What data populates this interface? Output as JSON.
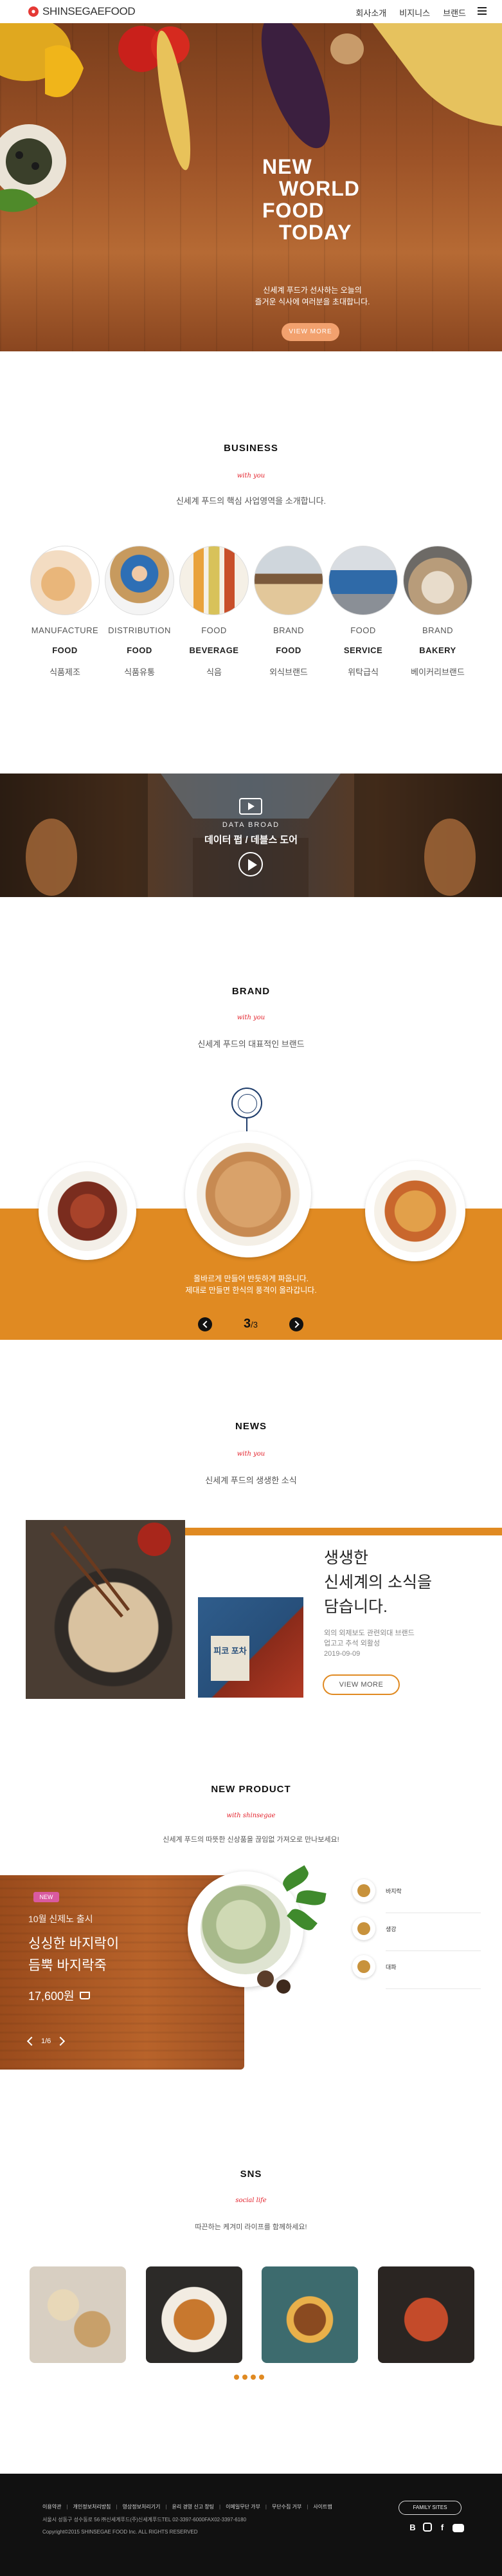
{
  "header": {
    "logo_text": "SHINSEGAEFOOD",
    "nav": [
      "회사소개",
      "비지니스",
      "브랜드"
    ]
  },
  "hero": {
    "title_lines": [
      "NEW",
      "WORLD",
      "FOOD",
      "TODAY"
    ],
    "subtitle_lines": [
      "신세계 푸드가 선사하는 오늘의",
      "즐거운 식사에 여러분을 초대합니다."
    ],
    "button": "VIEW MORE"
  },
  "business": {
    "title": "BUSINESS",
    "script": "with you",
    "desc": "신세계 푸드의 핵심 사업영역을 소개합니다.",
    "items": [
      {
        "t1": "MANUFACTURE",
        "t2": "FOOD",
        "t3": "식품제조"
      },
      {
        "t1": "DISTRIBUTION",
        "t2": "FOOD",
        "t3": "식품유통"
      },
      {
        "t1": "FOOD",
        "t2": "BEVERAGE",
        "t3": "식음"
      },
      {
        "t1": "BRAND",
        "t2": "FOOD",
        "t3": "외식브랜드"
      },
      {
        "t1": "FOOD",
        "t2": "SERVICE",
        "t3": "위탁급식"
      },
      {
        "t1": "BRAND",
        "t2": "BAKERY",
        "t3": "베이커리브랜드"
      }
    ]
  },
  "video": {
    "small": "DATA BROAD",
    "big": "데이터 펍 / 데블스 도어"
  },
  "brand": {
    "title": "BRAND",
    "script": "with you",
    "desc": "신세계 푸드의 대표적인 브랜드",
    "text_lines": [
      "올바르게 만들어 반듯하게 파웁니다.",
      "제대로 만들면 한식의 풍격이 올라갑니다."
    ],
    "page_current": "3",
    "page_total": "/3"
  },
  "news": {
    "title": "NEWS",
    "script": "with you",
    "desc": "신세계 푸드의 생생한 소식",
    "headline_lines": [
      "생생한",
      "신세계의 소식을",
      "담습니다."
    ],
    "meta_lines": [
      "외의 외제보도 관련외대 브랜드",
      "업고고 추석 외활성",
      "2019-09-09"
    ],
    "button": "VIEW MORE",
    "thumb_text": "피코 포차"
  },
  "product": {
    "title": "NEW PRODUCT",
    "script": "with shinsegae",
    "desc": "신세계 푸드의 따뜻한 신상품을 끊임없 가져오로 만나보세요!",
    "badge": "NEW",
    "category": "10월 신제노 출시",
    "name_lines": [
      "싱싱한 바지락이",
      "듬뿍 바지락죽"
    ],
    "price": "17,600원",
    "pager": "1/6",
    "list": [
      "바지락",
      "생강",
      "대파"
    ]
  },
  "sns": {
    "title": "SNS",
    "script": "social life",
    "desc": "따끈하는 케겨미 라이프를 함께하세요!"
  },
  "footer": {
    "links": [
      "이용약관",
      "개인정보처리방침",
      "영상정보처리기기",
      "윤리 경영 신고 창팅",
      "이메일무단 가부",
      "무단수집 거부",
      "사이트맵"
    ],
    "address": "서울시 성동구 성수동로 56 ㈜신세계푸드(주)신세계푸드TEL 02-3397-6000FAX02-3397-6180",
    "copyright": "Copyright©2015 SHINSEGAE FOOD Inc. ALL RIGHTS RESERVED",
    "family_site": "FAMILY SITES",
    "sns_icons": [
      "blog-icon",
      "instagram-icon",
      "facebook-icon",
      "youtube-icon"
    ]
  },
  "colors": {
    "accent": "#e08a22",
    "red": "#e3222b",
    "footer": "#111111"
  }
}
